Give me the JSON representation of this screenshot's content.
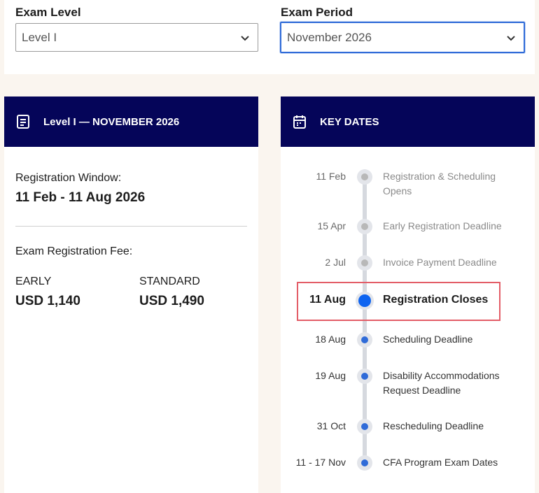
{
  "filters": {
    "exam_level": {
      "label": "Exam Level",
      "value": "Level I"
    },
    "exam_period": {
      "label": "Exam Period",
      "value": "November 2026"
    }
  },
  "summary_card": {
    "title": "Level I — NOVEMBER 2026",
    "registration_window_label": "Registration Window:",
    "registration_window_value": "11 Feb - 11 Aug 2026",
    "fee_label": "Exam Registration Fee:",
    "fees": [
      {
        "name": "EARLY",
        "amount": "USD 1,140"
      },
      {
        "name": "STANDARD",
        "amount": "USD 1,490"
      }
    ]
  },
  "key_dates": {
    "title": "KEY DATES",
    "items": [
      {
        "date": "11 Feb",
        "text": "Registration & Scheduling Opens",
        "status": "past"
      },
      {
        "date": "15 Apr",
        "text": "Early Registration Deadline",
        "status": "past"
      },
      {
        "date": "2 Jul",
        "text": "Invoice Payment Deadline",
        "status": "past"
      },
      {
        "date": "11 Aug",
        "text": "Registration Closes",
        "status": "current"
      },
      {
        "date": "18 Aug",
        "text": "Scheduling Deadline",
        "status": "upcoming"
      },
      {
        "date": "19 Aug",
        "text": "Disability Accommodations Request Deadline",
        "status": "upcoming"
      },
      {
        "date": "31 Oct",
        "text": "Rescheduling Deadline",
        "status": "upcoming"
      },
      {
        "date": "11 - 17 Nov",
        "text": "CFA Program Exam Dates",
        "status": "upcoming"
      }
    ]
  },
  "colors": {
    "header_bg": "#050559",
    "accent_blue": "#2f6bd8",
    "current_dot": "#0e64f0",
    "past_dot": "#b8b8b8",
    "highlight_border": "#e35d67"
  },
  "icons": {
    "document": "document-icon",
    "calendar": "calendar-icon",
    "chevron": "chevron-down-icon"
  }
}
